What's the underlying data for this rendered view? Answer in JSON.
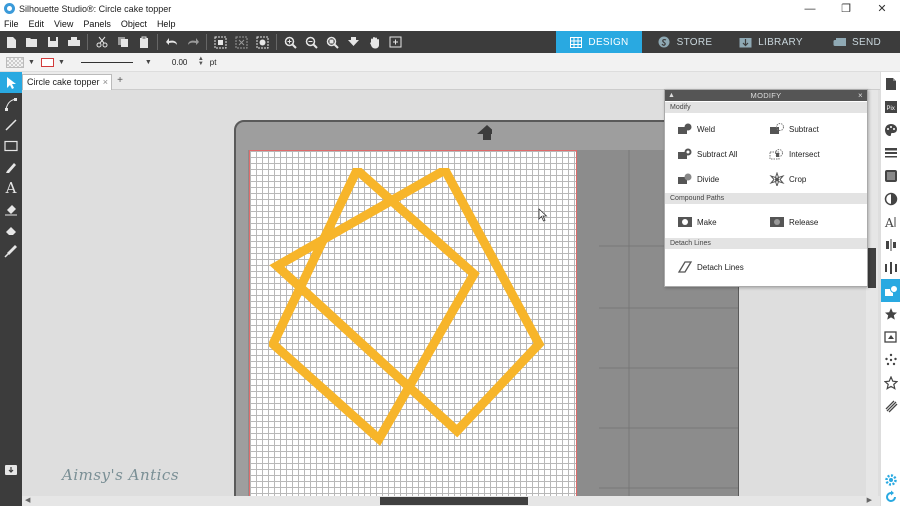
{
  "window": {
    "title": "Silhouette Studio®: Circle cake topper",
    "minimize_glyph": "—",
    "restore_glyph": "❐",
    "close_glyph": "✕"
  },
  "menu": [
    "File",
    "Edit",
    "View",
    "Panels",
    "Object",
    "Help"
  ],
  "main_tabs": [
    {
      "label": "DESIGN",
      "icon": "grid-icon",
      "active": true
    },
    {
      "label": "STORE",
      "icon": "store-icon",
      "active": false
    },
    {
      "label": "LIBRARY",
      "icon": "library-icon",
      "active": false
    },
    {
      "label": "SEND",
      "icon": "send-icon",
      "active": false
    }
  ],
  "line_settings": {
    "line_width_value": "0.00",
    "unit": "pt"
  },
  "document_tab": {
    "label": "Circle cake topper",
    "close_glyph": "×",
    "add_glyph": "+"
  },
  "modify_panel": {
    "title": "MODIFY",
    "sections": {
      "modify": {
        "header": "Modify",
        "buttons": [
          "Weld",
          "Subtract",
          "Subtract All",
          "Intersect",
          "Divide",
          "Crop"
        ]
      },
      "compound": {
        "header": "Compound Paths",
        "buttons": [
          "Make",
          "Release"
        ]
      },
      "detach": {
        "header": "Detach Lines",
        "buttons": [
          "Detach Lines"
        ]
      }
    }
  },
  "design": {
    "shape": "two overlapping squares (octagram)",
    "stroke_color": "#f7b52a"
  },
  "colors": {
    "accent": "#29a9e1",
    "toolbar_bg": "#3c3c3c",
    "mat_line": "#e06b6b"
  },
  "watermark": "Aimsy's Antics"
}
